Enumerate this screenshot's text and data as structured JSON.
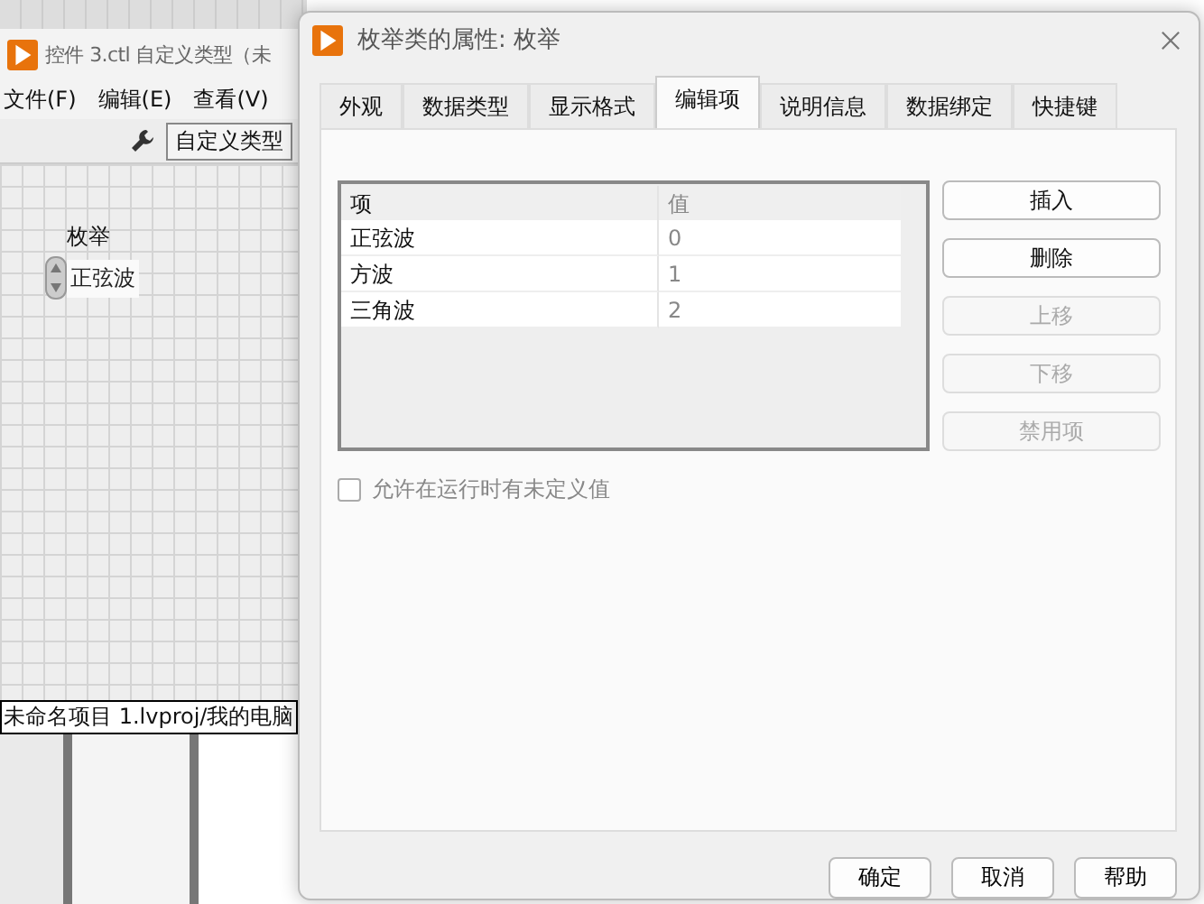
{
  "background_window": {
    "title": "控件 3.ctl 自定义类型（未",
    "menu": [
      "文件(F)",
      "编辑(E)",
      "查看(V)"
    ],
    "type_field": "自定义类型",
    "control_label": "枚举",
    "control_value": "正弦波",
    "project_path": "未命名项目 1.lvproj/我的电脑"
  },
  "dialog": {
    "title": "枚举类的属性: 枚举",
    "tabs": [
      {
        "label": "外观",
        "selected": false
      },
      {
        "label": "数据类型",
        "selected": false
      },
      {
        "label": "显示格式",
        "selected": false
      },
      {
        "label": "编辑项",
        "selected": true
      },
      {
        "label": "说明信息",
        "selected": false
      },
      {
        "label": "数据绑定",
        "selected": false
      },
      {
        "label": "快捷键",
        "selected": false
      }
    ],
    "table": {
      "columns": [
        "项",
        "值"
      ],
      "rows": [
        {
          "item": "正弦波",
          "value": "0"
        },
        {
          "item": "方波",
          "value": "1"
        },
        {
          "item": "三角波",
          "value": "2"
        }
      ]
    },
    "side_buttons": [
      {
        "label": "插入",
        "disabled": false
      },
      {
        "label": "删除",
        "disabled": false
      },
      {
        "label": "上移",
        "disabled": true
      },
      {
        "label": "下移",
        "disabled": true
      },
      {
        "label": "禁用项",
        "disabled": true
      }
    ],
    "checkbox": {
      "label": "允许在运行时有未定义值",
      "checked": false,
      "disabled": true
    },
    "buttons": [
      "确定",
      "取消",
      "帮助"
    ]
  }
}
